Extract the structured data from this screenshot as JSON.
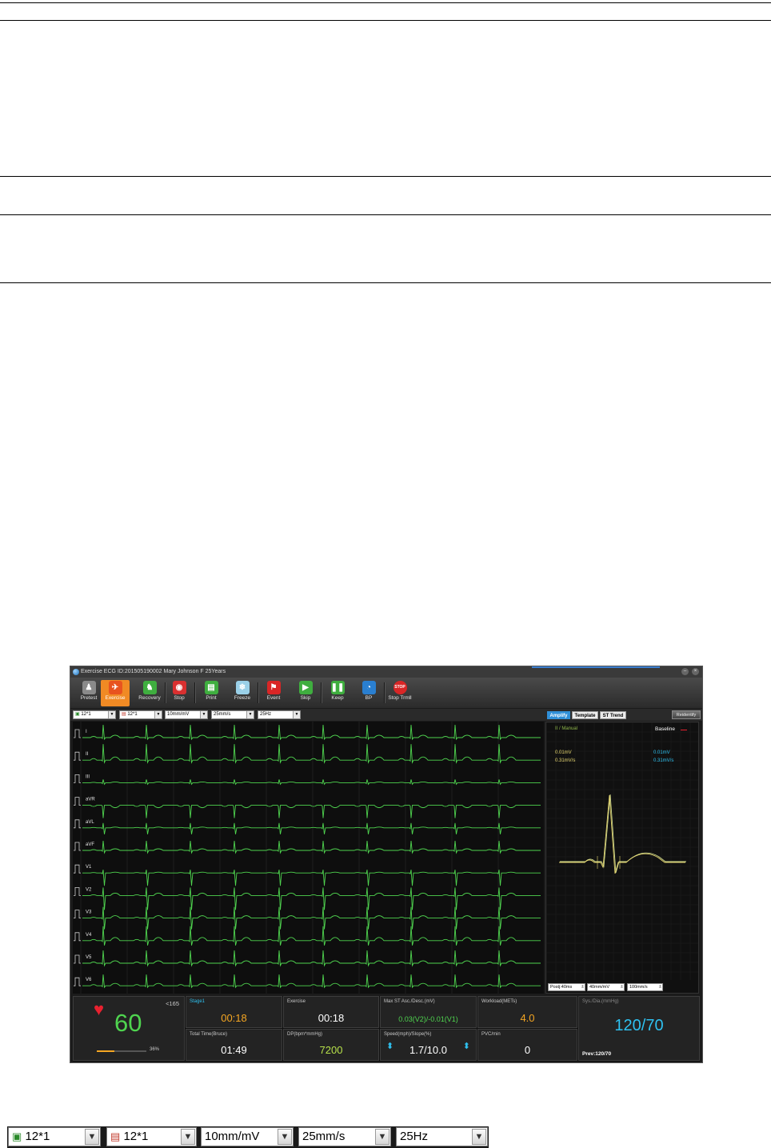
{
  "window": {
    "title": "Exercise ECG ID:201505190002 Mary Johnson  F  25Years"
  },
  "toolbar": [
    {
      "label": "Pretest",
      "icon": "person-standing-icon",
      "color": "#8a8a8a",
      "glyph": "♟"
    },
    {
      "label": "Exercise",
      "icon": "running-person-icon",
      "color": "#e8531f",
      "glyph": "✈",
      "active": true
    },
    {
      "label": "Recovery",
      "icon": "walking-person-icon",
      "color": "#3fae3f",
      "glyph": "♞"
    },
    {
      "label": "Stop",
      "icon": "stop-target-icon",
      "color": "#d93030",
      "glyph": "◉"
    },
    {
      "label": "Print",
      "icon": "printer-icon",
      "color": "#3fae3f",
      "glyph": "▤"
    },
    {
      "label": "Freeze",
      "icon": "snowflake-icon",
      "color": "#9ad0e8",
      "glyph": "❄"
    },
    {
      "label": "Event",
      "icon": "flag-icon",
      "color": "#d92626",
      "glyph": "⚑"
    },
    {
      "label": "Skip",
      "icon": "skip-icon",
      "color": "#3fae3f",
      "glyph": "▶"
    },
    {
      "label": "Keep",
      "icon": "pause-icon",
      "color": "#3fae3f",
      "glyph": "❚❚"
    },
    {
      "label": "BP",
      "icon": "gauge-icon",
      "color": "#2a7fd0",
      "glyph": "◔"
    },
    {
      "label": "Stop Trmll",
      "icon": "stop-sign-icon",
      "color": "#d92626",
      "glyph": "STOP"
    }
  ],
  "controls": {
    "display_layout": "12*1",
    "print_layout": "12*1",
    "gain": "10mm/mV",
    "speed": "25mm/s",
    "filter": "25Hz"
  },
  "leads": [
    "I",
    "II",
    "III",
    "aVR",
    "aVL",
    "aVF",
    "V1",
    "V2",
    "V3",
    "V4",
    "V5",
    "V6"
  ],
  "right_tabs": {
    "tabs": [
      "Amplify",
      "Template",
      "ST Trend"
    ],
    "selected": "Amplify",
    "reidentify": "Reidentify"
  },
  "amplify": {
    "lead_label": "II / Manual",
    "baseline_label": "Baseline",
    "left_st": "0.01mV",
    "left_slope": "0.31mV/s",
    "right_st": "0.01mV",
    "right_slope": "0.31mV/s",
    "postj": "Postj:40ms",
    "gain": "40mm/mV",
    "speed": "100mm/s"
  },
  "vitals": {
    "hr_limit": "<165",
    "hr_value": "60",
    "hr_percent_label": "36%",
    "hr_percent": 36,
    "stage_label": "Stage1",
    "stage_time": "00:18",
    "exercise_label": "Exercise",
    "exercise_time": "00:18",
    "st_label": "Max ST Asc./Desc.(mV)",
    "st_value": "0.03(V2)/-0.01(V1)",
    "workload_label": "Workload(METs)",
    "workload_value": "4.0",
    "bp_label": "Sys./Dia.(mmHg)",
    "bp_value": "120/70",
    "bp_prev": "Prev:120/70",
    "total_label": "Total Time(Bruce)",
    "total_value": "01:49",
    "dp_label": "DP(bpm*mmHg)",
    "dp_value": "7200",
    "speed_label": "Speed(mph)/Slope(%)",
    "speed_value": "1.7/10.0",
    "pvc_label": "PVC/min",
    "pvc_value": "0"
  },
  "colors": {
    "trace_green": "#4fd44f",
    "amber": "#f5a623",
    "cyan": "#2ec1f0",
    "template_yellow": "#e8d870",
    "heart_red": "#e8212f"
  }
}
